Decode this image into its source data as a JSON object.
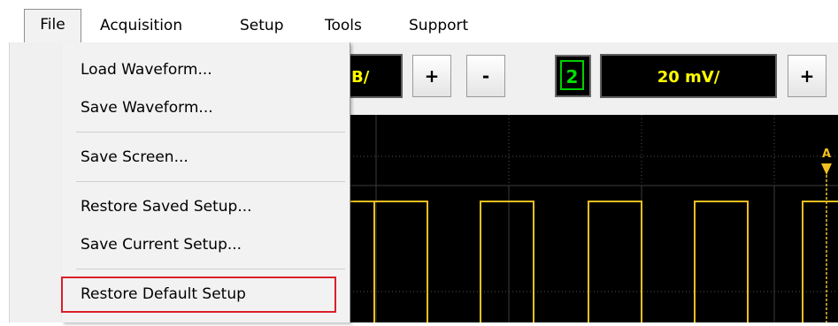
{
  "menubar": {
    "items": [
      "File",
      "Acquisition",
      "Setup",
      "Tools",
      "Support"
    ]
  },
  "file_menu": {
    "items": [
      "Load Waveform...",
      "Save Waveform...",
      "Save Screen...",
      "Restore Saved Setup...",
      "Save Current Setup...",
      "Restore Default Setup"
    ],
    "highlighted": "Restore Default Setup"
  },
  "toolbar": {
    "scale_partial": "B/",
    "plus_label": "+",
    "minus_label": "-",
    "channel_number": "2",
    "channel_scale": "20 mV/"
  },
  "scope": {
    "trigger_marker": "A",
    "trace_color": "#f0c020",
    "grid_color": "#555555"
  },
  "colors": {
    "highlight_box": "#d9202a",
    "channel_indicator": "#00d000",
    "scale_text": "#ffff00"
  }
}
